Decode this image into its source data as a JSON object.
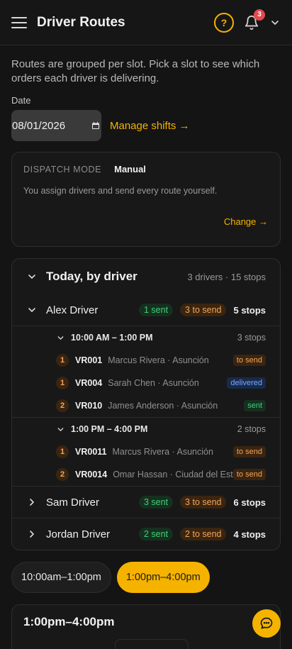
{
  "header": {
    "title": "Driver Routes",
    "notification_count": "3"
  },
  "intro": "Routes are grouped per slot. Pick a slot to see which orders each driver is delivering.",
  "date": {
    "label": "Date",
    "value": "08/01/2026"
  },
  "manage_shifts": "Manage shifts →",
  "dispatch": {
    "label": "DISPATCH MODE",
    "value": "Manual",
    "description": "You assign drivers and send every route yourself.",
    "change": "Change →"
  },
  "today": {
    "title": "Today, by driver",
    "meta": "3 drivers · 15 stops",
    "drivers": [
      {
        "name": "Alex Driver",
        "sent": "1 sent",
        "to_send": "3 to send",
        "stops": "5 stops"
      },
      {
        "name": "Sam Driver",
        "sent": "3 sent",
        "to_send": "3 to send",
        "stops": "6 stops"
      },
      {
        "name": "Jordan Driver",
        "sent": "2 sent",
        "to_send": "2 to send",
        "stops": "4 stops"
      }
    ],
    "slots": [
      {
        "time": "10:00 AM – 1:00 PM",
        "count": "3 stops",
        "orders": [
          {
            "num": "1",
            "id": "VR001",
            "customer": "Marcus Rivera · Asunción",
            "status": "to send"
          },
          {
            "num": "1",
            "id": "VR004",
            "customer": "Sarah Chen · Asunción",
            "status": "delivered"
          },
          {
            "num": "2",
            "id": "VR010",
            "customer": "James Anderson · Asunción",
            "status": "sent"
          }
        ]
      },
      {
        "time": "1:00 PM – 4:00 PM",
        "count": "2 stops",
        "orders": [
          {
            "num": "1",
            "id": "VR0011",
            "customer": "Marcus Rivera · Asunción",
            "status": "to send"
          },
          {
            "num": "2",
            "id": "VR0014",
            "customer": "Omar Hassan · Ciudad del Este",
            "status": "to send"
          }
        ]
      }
    ]
  },
  "slot_chips": [
    "10:00am–1:00pm",
    "1:00pm–4:00pm"
  ],
  "slot_card_title": "1:00pm–4:00pm",
  "colors": {
    "accent": "#f5b300",
    "sent": "#3fcf7a",
    "to_send": "#f5a55b",
    "delivered": "#7aa6ff"
  }
}
